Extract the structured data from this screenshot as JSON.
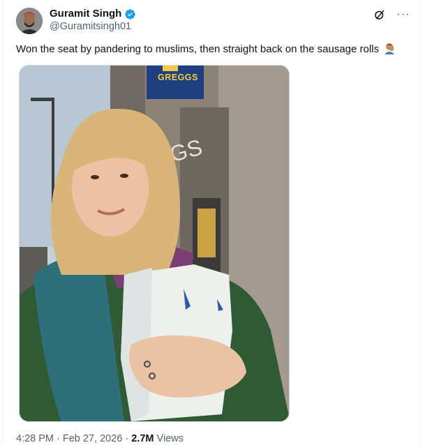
{
  "author": {
    "display_name": "Guramit Singh",
    "handle": "@Guramitsingh01",
    "verified": true,
    "avatar_icon": "avatar-photo"
  },
  "actions": {
    "grok_icon": "grok-icon",
    "more_icon": "more-icon"
  },
  "tweet": {
    "text": "Won the seat by pandering to muslims, then straight back on the sausage rolls",
    "emoji": "person-facepalming-emoji"
  },
  "media": {
    "shop_sign": "GREGGS",
    "wall_lettering": "GGS"
  },
  "meta": {
    "time": "4:28 PM",
    "separator": " · ",
    "date": "Feb 27, 2026",
    "views_count": "2.7M",
    "views_label": "Views"
  },
  "colors": {
    "verified_blue": "#1d9bf0",
    "muted_text": "#536471",
    "greggs_blue": "#1e3f80",
    "greggs_yellow": "#f7c948"
  }
}
